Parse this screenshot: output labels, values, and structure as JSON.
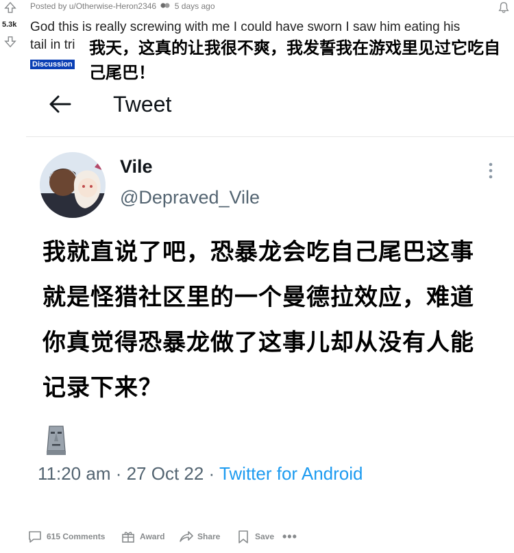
{
  "post": {
    "score": "5.3k",
    "meta_text": "Posted by u/Otherwise-Heron2346",
    "age": "5 days ago",
    "title_line1": "God this is really screwing with me I could have sworn I saw him eating his",
    "title_line2": "tail in tri",
    "title_translation": "我天，这真的让我很不爽，我发誓我在游戏里见过它吃自己尾巴！",
    "flair": "Discussion"
  },
  "tweet": {
    "header": "Tweet",
    "display_name": "Vile",
    "handle": "@Depraved_Vile",
    "body": "我就直说了吧，恐暴龙会吃自己尾巴这事就是怪猎社区里的一个曼德拉效应，难道你真觉得恐暴龙做了这事儿却从没有人能记录下来？",
    "time": "11:20 am · 27 Oct 22 · ",
    "source": "Twitter for Android",
    "emoji": "moai-icon"
  },
  "actions": {
    "comments": "615 Comments",
    "award": "Award",
    "share": "Share",
    "save": "Save",
    "more": "•••"
  },
  "colors": {
    "flair_bg": "#0a3fb4",
    "link_blue": "#1d9bf0",
    "muted_gray": "#536471",
    "reddit_gray": "#878a8c"
  }
}
